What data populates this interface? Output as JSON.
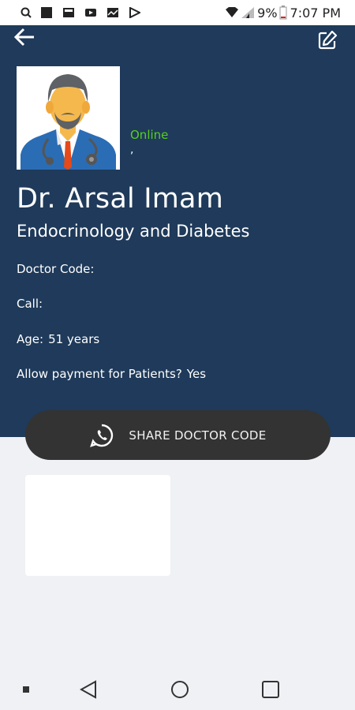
{
  "status_bar": {
    "battery": "9%",
    "time": "7:07 PM",
    "icons": [
      "search-icon",
      "app-square-icon",
      "gallery-icon",
      "youtube-icon",
      "photos-icon",
      "play-store-icon",
      "wifi-icon",
      "signal-icon",
      "battery-icon"
    ]
  },
  "header": {
    "back_icon": "arrow-left-icon",
    "edit_icon": "edit-icon"
  },
  "profile": {
    "avatar_icon": "doctor-avatar-icon",
    "status": "Online",
    "status_sub": ",",
    "name": "Dr. Arsal Imam",
    "specialty": "Endocrinology and Diabetes",
    "doctor_code_label": "Doctor Code:",
    "doctor_code_value": "",
    "call_label": "Call:",
    "call_value": "",
    "age_label": "Age:",
    "age_value": "51 years",
    "payment_label": "Allow payment for Patients?",
    "payment_value": "Yes"
  },
  "share": {
    "label": "SHARE DOCTOR CODE",
    "icon": "whatsapp-icon"
  },
  "nav": {
    "items": [
      "dot-icon",
      "back-triangle-icon",
      "home-circle-icon",
      "recents-square-icon"
    ]
  },
  "colors": {
    "header_bg": "#1f3a5a",
    "online": "#54d11b",
    "share_btn": "#333333",
    "page_bg": "#eff1f4"
  }
}
